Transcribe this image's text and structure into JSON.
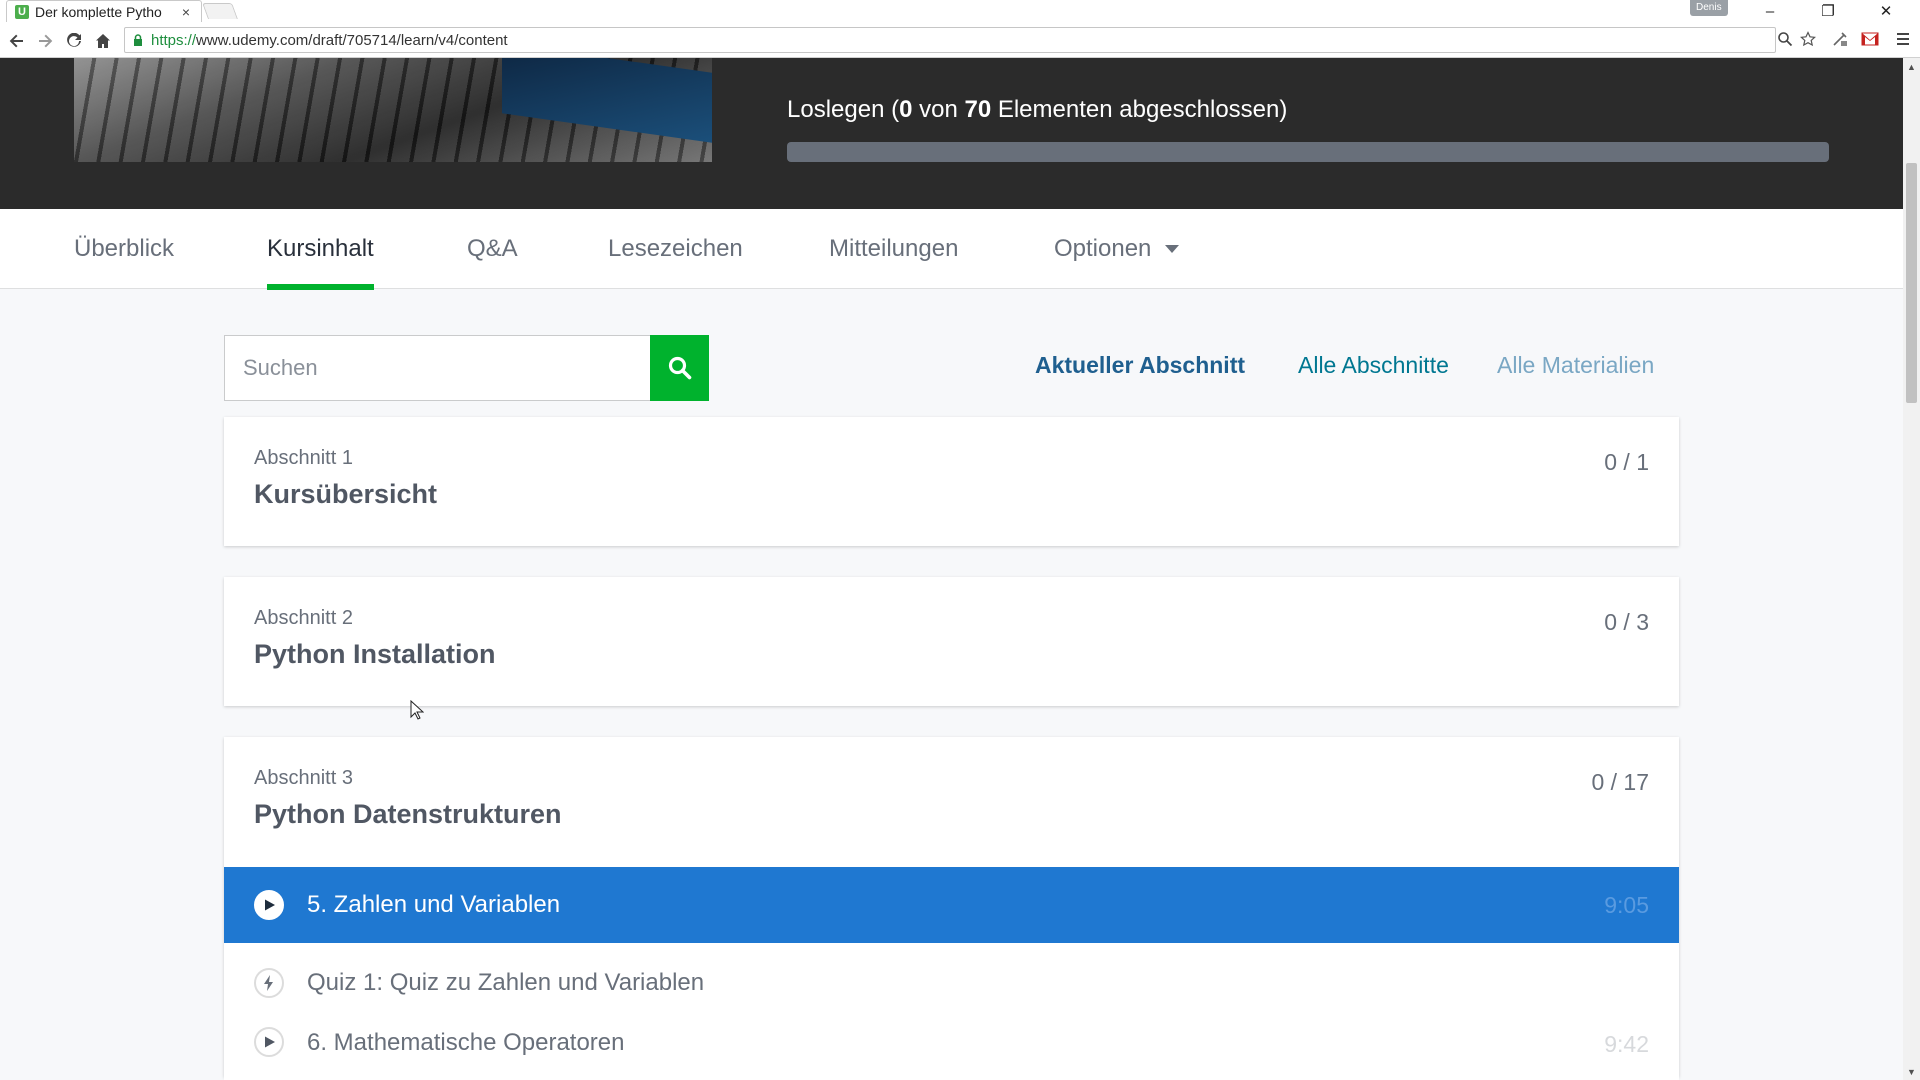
{
  "browser": {
    "tab_title": "Der komplette Pytho",
    "tab_close": "×",
    "favicon_letter": "U",
    "user_name": "Denis",
    "url_scheme": "https://",
    "url_rest": "www.udemy.com/draft/705714/learn/v4/content",
    "minimize": "–",
    "restore": "❐",
    "close": "✕",
    "icons": [
      "back-arrow-icon",
      "forward-arrow-icon",
      "reload-icon",
      "home-icon",
      "lock-icon",
      "zoom-icon",
      "star-icon",
      "extension-icon",
      "gmail-icon",
      "menu-icon"
    ]
  },
  "hero": {
    "progress_prefix": "Loslegen (",
    "completed": "0",
    "progress_mid": " von ",
    "total": "70",
    "progress_suffix": " Elementen abgeschlossen)",
    "progress_fraction": 0
  },
  "tabs": [
    {
      "label": "Überblick"
    },
    {
      "label": "Kursinhalt"
    },
    {
      "label": "Q&A"
    },
    {
      "label": "Lesezeichen"
    },
    {
      "label": "Mitteilungen"
    },
    {
      "label": "Optionen"
    }
  ],
  "search": {
    "placeholder": "Suchen"
  },
  "filters": [
    "Aktueller Abschnitt",
    "Alle Abschnitte",
    "Alle Materialien"
  ],
  "sections": [
    {
      "number": "Abschnitt 1",
      "title": "Kursübersicht",
      "count": "0 / 1"
    },
    {
      "number": "Abschnitt 2",
      "title": "Python Installation",
      "count": "0 / 3"
    },
    {
      "number": "Abschnitt 3",
      "title": "Python Datenstrukturen",
      "count": "0 / 17"
    }
  ],
  "lectures": [
    {
      "title": "5. Zahlen und Variablen",
      "duration": "9:05",
      "type": "play"
    },
    {
      "title": "Quiz 1: Quiz zu Zahlen und Variablen",
      "duration": "",
      "type": "quiz"
    },
    {
      "title": "6. Mathematische Operatoren",
      "duration": "9:42",
      "type": "play"
    }
  ],
  "colors": {
    "accent_green": "#00b22d",
    "current_lecture_blue": "#1f78d1",
    "hero_bg": "#2b2b2b",
    "link_blue": "#007791"
  }
}
